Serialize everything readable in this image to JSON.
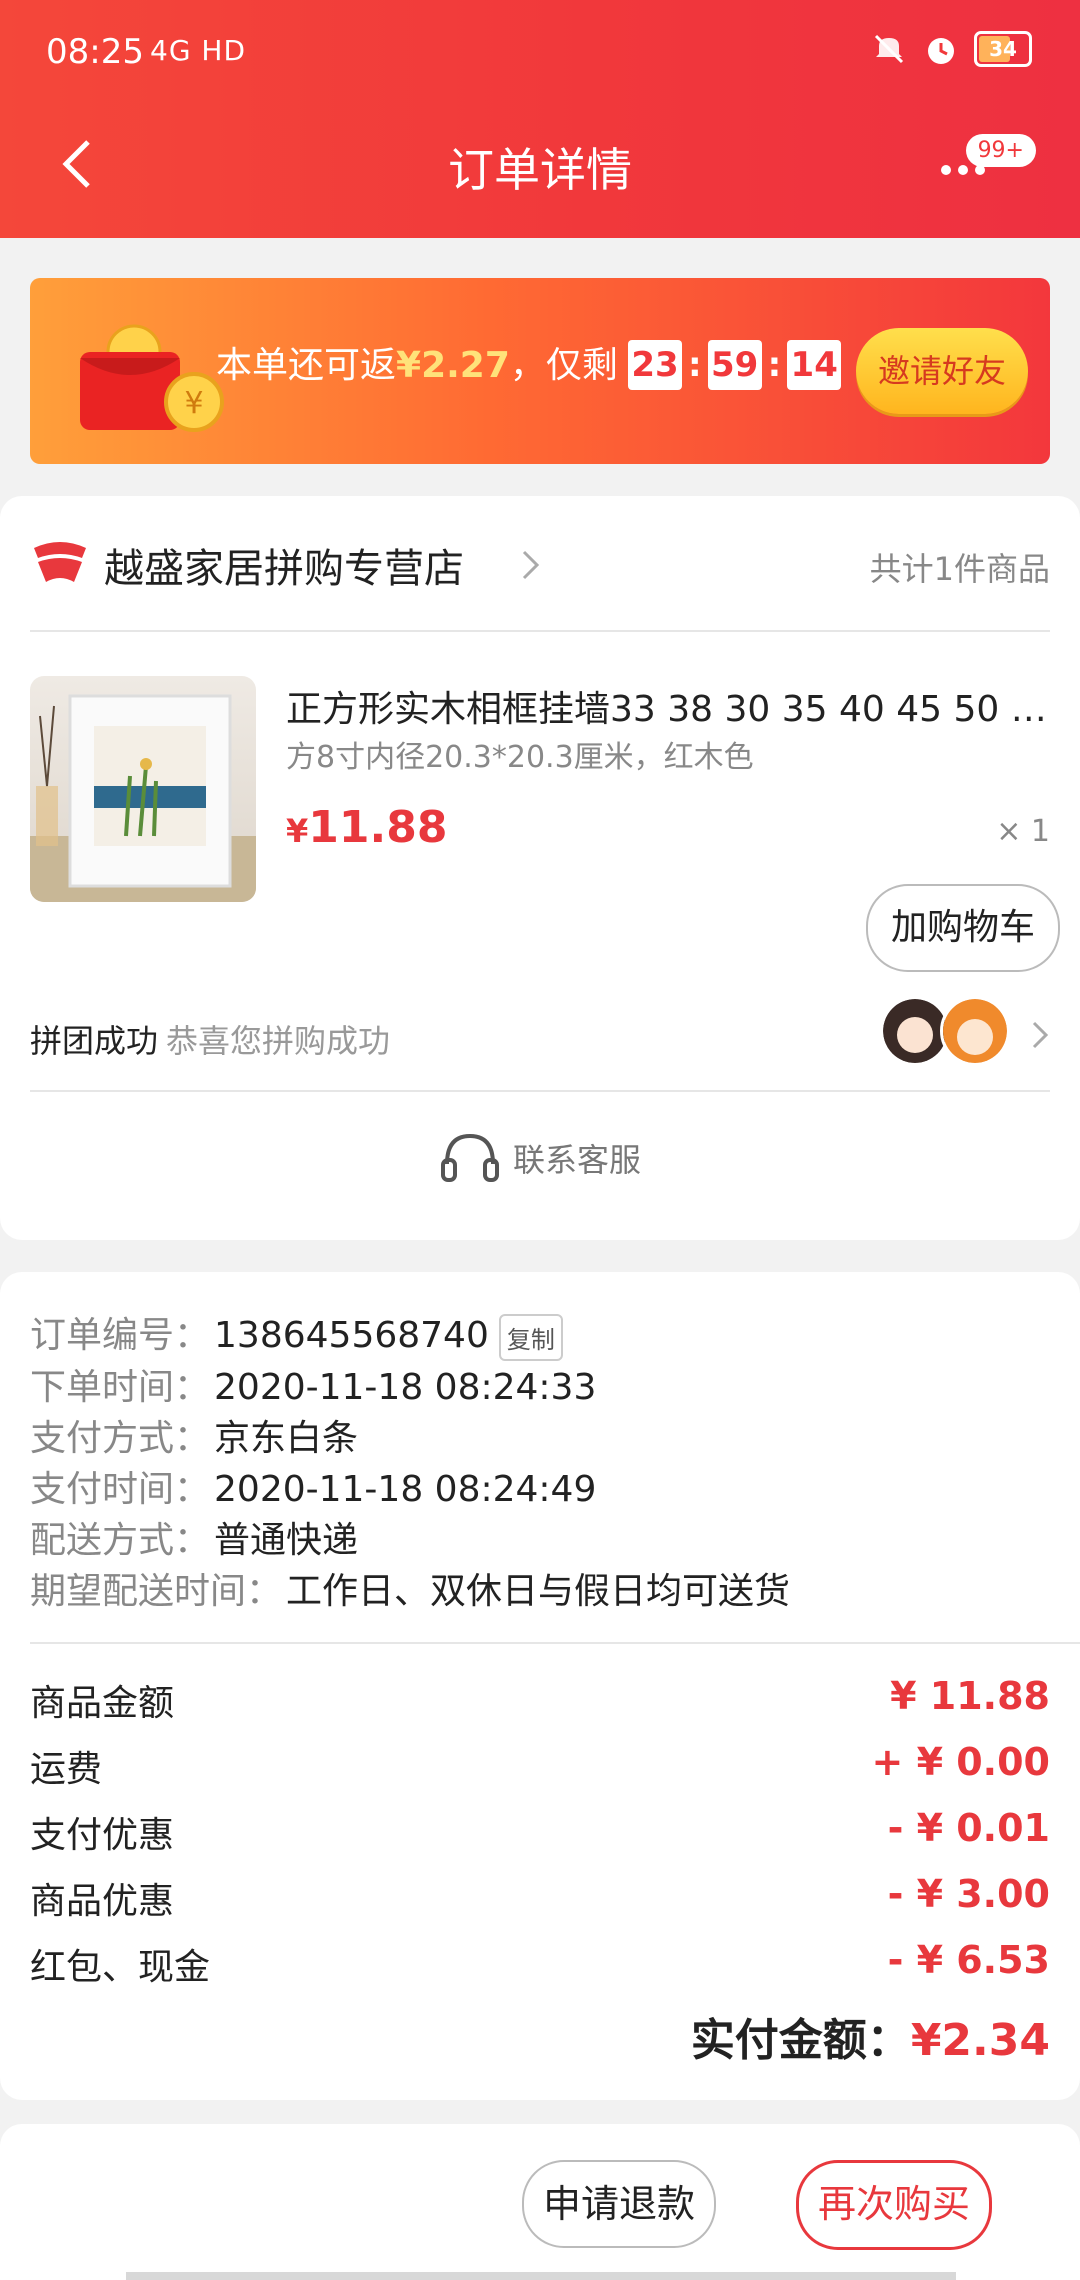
{
  "status_bar": {
    "time": "08:25",
    "network": "4G HD",
    "battery": "34"
  },
  "nav": {
    "title": "订单详情",
    "badge": "99+"
  },
  "banner": {
    "text_prefix": "本单还可返",
    "amount": "¥2.27",
    "text_suffix": "，仅剩",
    "timer": [
      "23",
      "59",
      "14"
    ],
    "invite_label": "邀请好友"
  },
  "store": {
    "name": "越盛家居拼购专营店",
    "count": "共计1件商品"
  },
  "product": {
    "title": "正方形实木相框挂墙33 38 30 35 40 45 50 60…",
    "spec": "方8寸内径20.3*20.3厘米，红木色",
    "price_symbol": "¥",
    "price": "11.88",
    "qty": "× 1",
    "add_cart_label": "加购物车"
  },
  "group": {
    "label": "拼团成功",
    "sub": "恭喜您拼购成功"
  },
  "service": {
    "label": "联系客服"
  },
  "order_info": [
    {
      "label": "订单编号：",
      "value": "138645568740",
      "copy": "复制"
    },
    {
      "label": "下单时间：",
      "value": "2020-11-18 08:24:33"
    },
    {
      "label": "支付方式：",
      "value": "京东白条"
    },
    {
      "label": "支付时间：",
      "value": "2020-11-18 08:24:49"
    },
    {
      "label": "配送方式：",
      "value": "普通快递"
    },
    {
      "label": "期望配送时间：",
      "value": "工作日、双休日与假日均可送货"
    }
  ],
  "amounts": [
    {
      "label": "商品金额",
      "value": "¥ 11.88"
    },
    {
      "label": "运费",
      "value": "+ ¥ 0.00"
    },
    {
      "label": "支付优惠",
      "value": "- ¥ 0.01"
    },
    {
      "label": "商品优惠",
      "value": "- ¥ 3.00"
    },
    {
      "label": "红包、现金",
      "value": "- ¥ 6.53"
    }
  ],
  "total": {
    "label": "实付金额：",
    "value": "¥2.34"
  },
  "actions": {
    "refund": "申请退款",
    "rebuy": "再次购买"
  },
  "colors": {
    "primary_red": "#f1383b",
    "price_red": "#e8383d",
    "invite_yellow": "#ffc62b"
  },
  "icons": [
    "back-arrow-icon",
    "more-icon",
    "red-envelope-icon",
    "store-logo-icon",
    "chevron-right-icon",
    "headset-icon",
    "mute-icon",
    "alarm-icon",
    "battery-icon"
  ]
}
